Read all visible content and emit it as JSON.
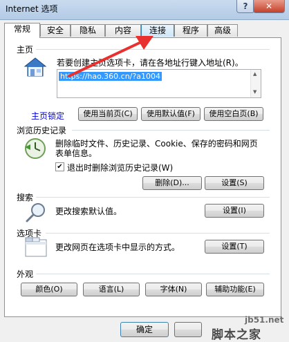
{
  "window": {
    "title": "Internet 选项",
    "help": "?",
    "close": "✕"
  },
  "tabs": [
    {
      "label": "常规"
    },
    {
      "label": "安全"
    },
    {
      "label": "隐私"
    },
    {
      "label": "内容"
    },
    {
      "label": "连接"
    },
    {
      "label": "程序"
    },
    {
      "label": "高级"
    }
  ],
  "home": {
    "title": "主页",
    "instruction": "若要创建主页选项卡，请在各地址行键入地址(R)。",
    "url": "https://hao.360.cn/?a1004",
    "locked": "主页锁定",
    "use_current": "使用当前页(C)",
    "use_default": "使用默认值(F)",
    "use_blank": "使用空白页(B)"
  },
  "history": {
    "title": "浏览历史记录",
    "desc1": "删除临时文件、历史记录、Cookie、保存的密码和网页",
    "desc2": "表单信息。",
    "checkbox": "退出时删除浏览历史记录(W)",
    "delete": "删除(D)...",
    "settings": "设置(S)"
  },
  "search": {
    "title": "搜索",
    "desc": "更改搜索默认值。",
    "settings": "设置(I)"
  },
  "tabsec": {
    "title": "选项卡",
    "desc": "更改网页在选项卡中显示的方式。",
    "settings": "设置(T)"
  },
  "appearance": {
    "title": "外观",
    "colors": "颜色(O)",
    "languages": "语言(L)",
    "fonts": "字体(N)",
    "accessibility": "辅助功能(E)"
  },
  "footer": {
    "ok": "确定"
  },
  "watermark": {
    "line1": "jb51.net",
    "line2": "脚本之家"
  },
  "colors": {
    "accent": "#3399ff",
    "arrow": "#e8302e",
    "link": "#0000cc"
  }
}
